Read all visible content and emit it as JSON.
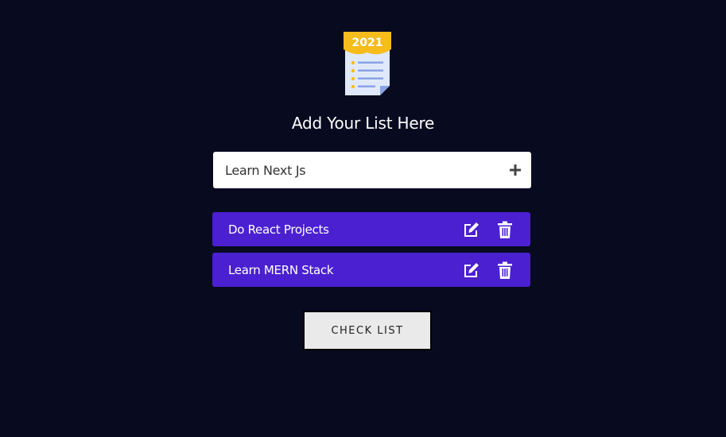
{
  "logo": {
    "year": "2021",
    "icon": "checklist-notepad-icon"
  },
  "header": {
    "title": "Add Your List Here"
  },
  "input": {
    "value": "Learn Next Js",
    "add_icon": "plus-icon"
  },
  "items": [
    {
      "label": "Do React Projects",
      "edit_icon": "edit-icon",
      "delete_icon": "trash-icon"
    },
    {
      "label": "Learn MERN Stack",
      "edit_icon": "edit-icon",
      "delete_icon": "trash-icon"
    }
  ],
  "actions": {
    "check_list_label": "CHECK LIST"
  },
  "colors": {
    "background": "#080b20",
    "item_background": "#4b20d0",
    "logo_banner": "#f6bc1c"
  }
}
